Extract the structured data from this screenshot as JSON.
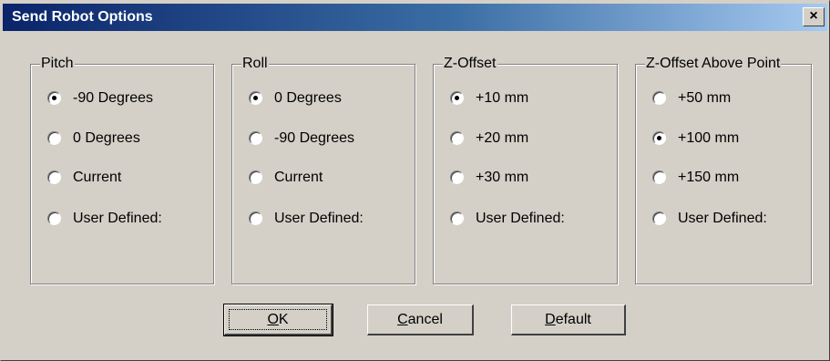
{
  "window": {
    "title": "Send Robot Options",
    "close_glyph": "×",
    "close_icon": "close-icon"
  },
  "groups": [
    {
      "label": "Pitch",
      "options": [
        "-90 Degrees",
        "0 Degrees",
        "Current",
        "User Defined:"
      ],
      "selected": 0
    },
    {
      "label": "Roll",
      "options": [
        "0 Degrees",
        "-90 Degrees",
        "Current",
        "User Defined:"
      ],
      "selected": 0
    },
    {
      "label": "Z-Offset",
      "options": [
        "+10 mm",
        "+20 mm",
        "+30 mm",
        "User Defined:"
      ],
      "selected": 0
    },
    {
      "label": "Z-Offset Above Point",
      "options": [
        "+50 mm",
        "+100 mm",
        "+150 mm",
        "User Defined:"
      ],
      "selected": 1
    }
  ],
  "buttons": {
    "ok": {
      "mnemonic": "O",
      "rest": "K"
    },
    "cancel": {
      "mnemonic": "C",
      "rest": "ancel"
    },
    "default": {
      "mnemonic": "D",
      "rest": "efault"
    }
  }
}
